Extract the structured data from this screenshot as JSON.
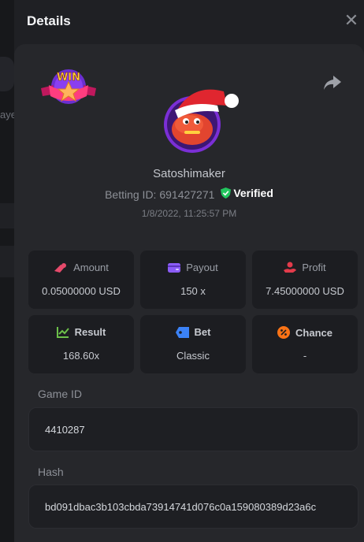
{
  "background": {
    "partial_text": "aye"
  },
  "header": {
    "title": "Details",
    "close_symbol": "✕"
  },
  "badge": {
    "label": "WIN"
  },
  "player": {
    "username": "Satoshimaker",
    "betting_id_label": "Betting ID: 691427271",
    "verified_label": "Verified",
    "timestamp": "1/8/2022, 11:25:57 PM"
  },
  "stats": [
    {
      "label": "Amount",
      "value": "0.05000000 USD",
      "icon": "coins-icon",
      "color": "#e64a6b"
    },
    {
      "label": "Payout",
      "value": "150 x",
      "icon": "wallet-icon",
      "color": "#8b5cf6"
    },
    {
      "label": "Profit",
      "value": "7.45000000 USD",
      "icon": "hand-coin-icon",
      "color": "#e23b4b"
    },
    {
      "label": "Result",
      "value": "168.60x",
      "icon": "chart-icon",
      "color": "#6cc04a"
    },
    {
      "label": "Bet",
      "value": "Classic",
      "icon": "ticket-icon",
      "color": "#3b82f6"
    },
    {
      "label": "Chance",
      "value": "-",
      "icon": "percent-icon",
      "color": "#f97316"
    }
  ],
  "game": {
    "label": "Game ID",
    "value": "4410287"
  },
  "hash": {
    "label": "Hash",
    "value": "bd091dbac3b103cbda73914741d076c0a159080389d23a6c"
  }
}
